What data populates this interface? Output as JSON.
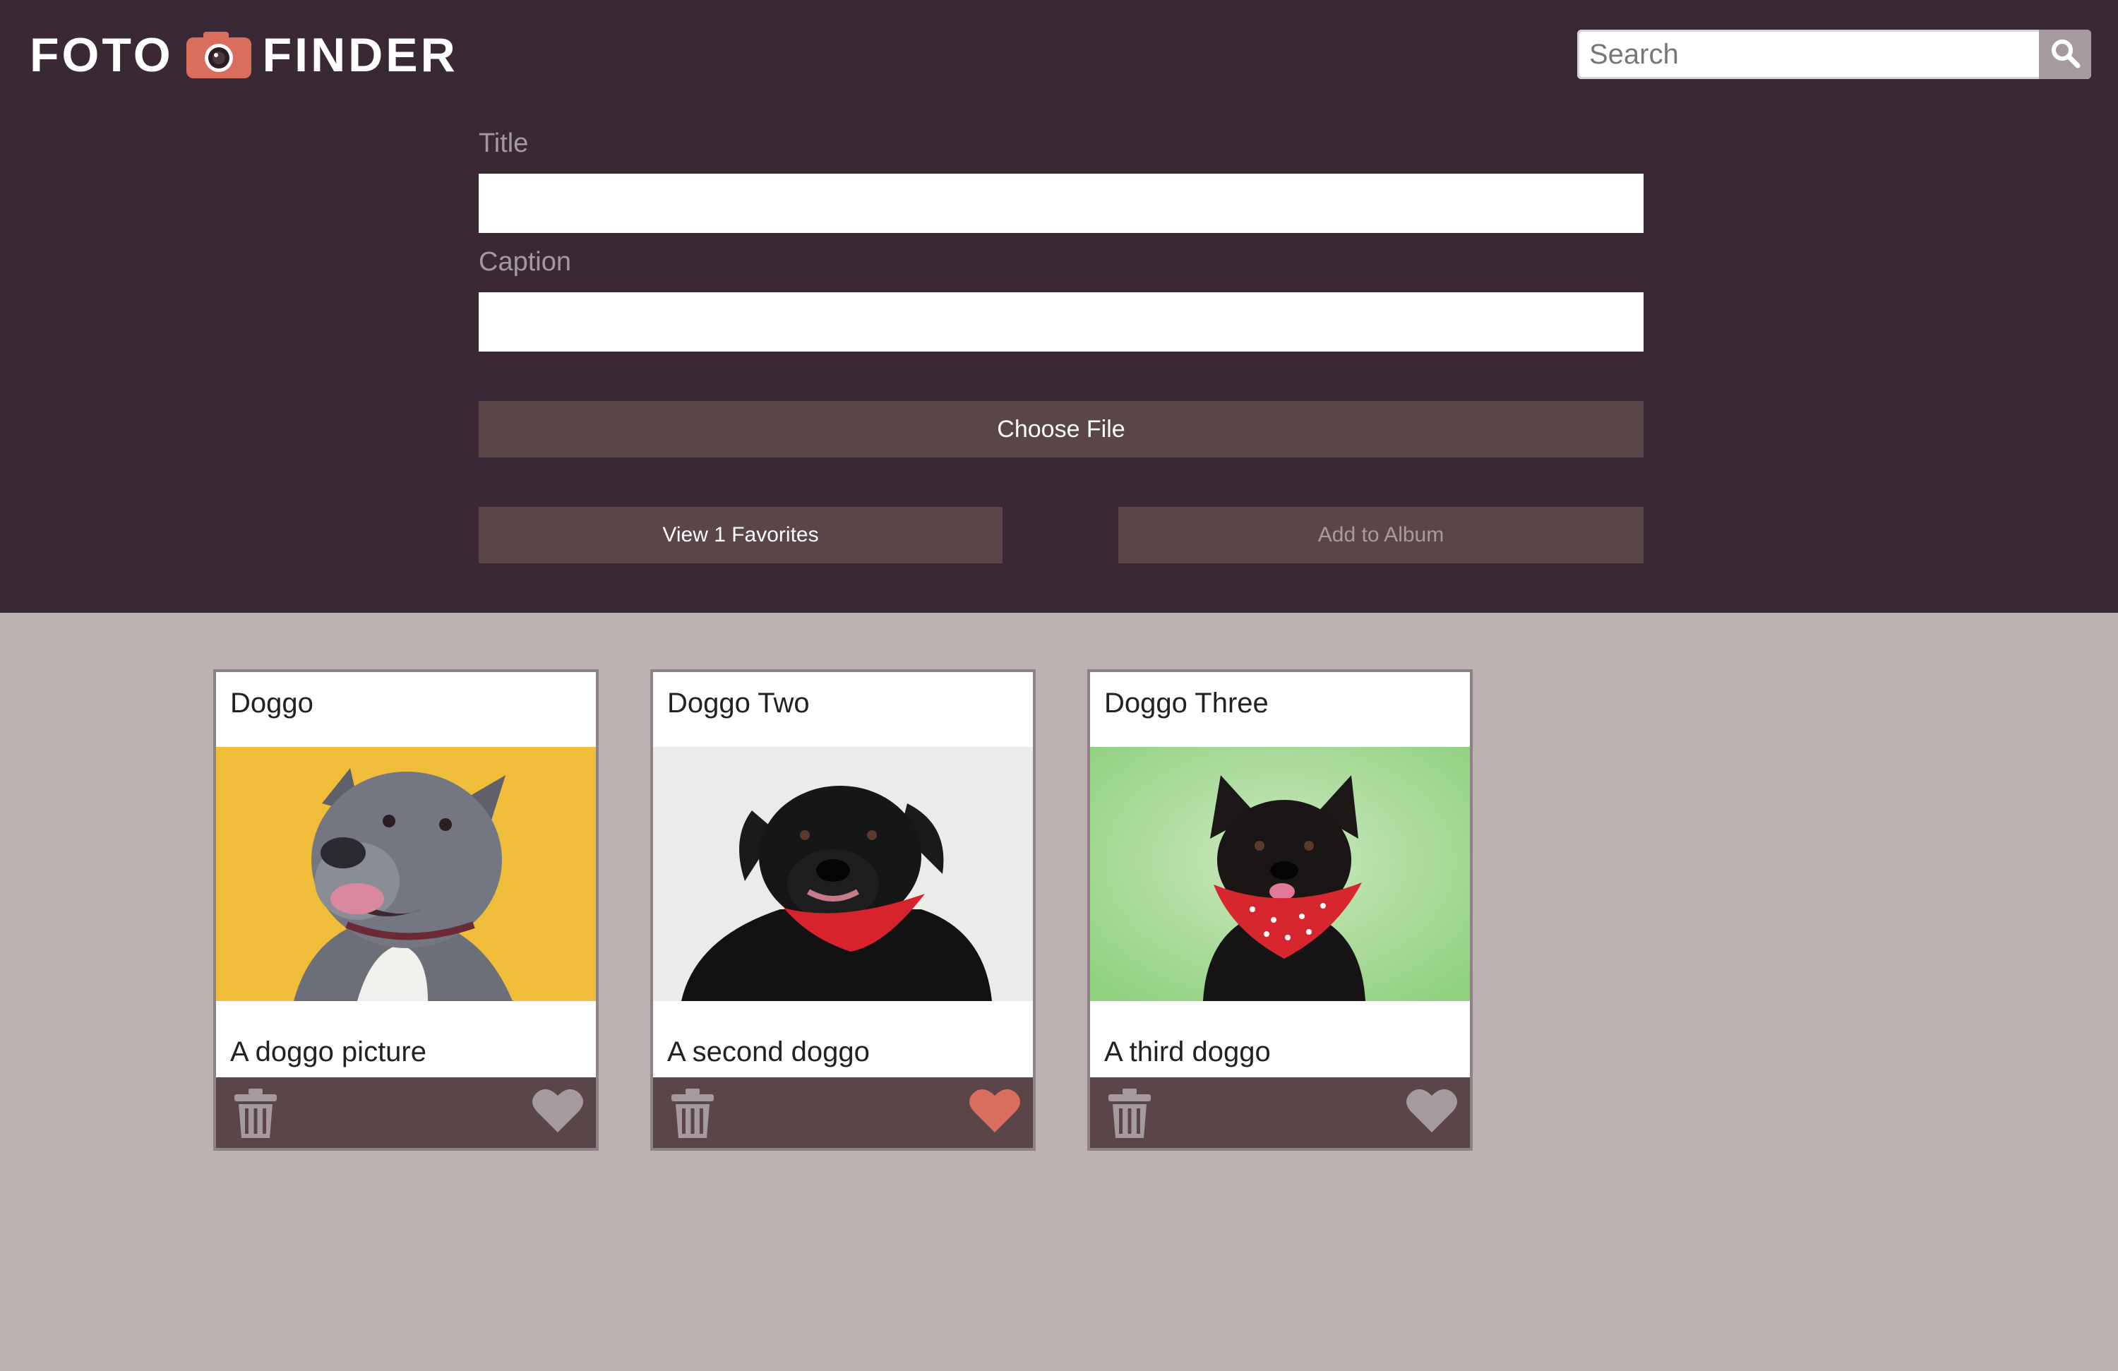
{
  "brand": {
    "word_left": "FOTO",
    "word_right": "FINDER",
    "logo_icon": "camera-icon",
    "accent_color": "#d96e5c"
  },
  "search": {
    "placeholder": "Search",
    "value": "",
    "icon": "search-icon"
  },
  "form": {
    "title_label": "Title",
    "title_value": "",
    "caption_label": "Caption",
    "caption_value": "",
    "choose_file_label": "Choose File",
    "view_favorites_label": "View 1 Favorites",
    "add_to_album_label": "Add to Album"
  },
  "photos": [
    {
      "title": "Doggo",
      "caption": "A doggo picture",
      "favorited": false
    },
    {
      "title": "Doggo Two",
      "caption": "A second doggo",
      "favorited": true
    },
    {
      "title": "Doggo Three",
      "caption": "A third doggo",
      "favorited": false
    }
  ],
  "colors": {
    "header_bg": "#3a2935",
    "body_bg": "#bdb1b2",
    "button_bg": "#5a4548",
    "heart_active": "#d96e5c",
    "heart_inactive": "#a59b9e"
  }
}
